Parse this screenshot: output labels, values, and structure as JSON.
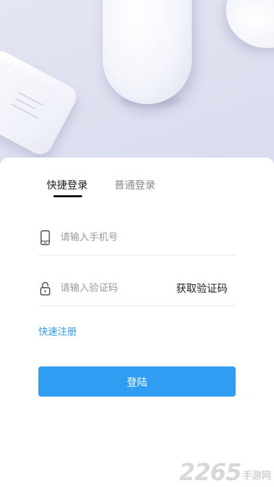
{
  "tabs": [
    {
      "label": "快捷登录",
      "active": true
    },
    {
      "label": "普通登录",
      "active": false
    }
  ],
  "phone_field": {
    "icon": "phone-icon",
    "placeholder": "请输入手机号",
    "value": ""
  },
  "code_field": {
    "icon": "lock-icon",
    "placeholder": "请输入验证码",
    "value": "",
    "get_code_label": "获取验证码"
  },
  "register_link": "快速注册",
  "login_button": "登陆",
  "watermark": {
    "number": "2265",
    "name": "手游网"
  },
  "colors": {
    "accent": "#2f9df2",
    "link": "#2f9af0",
    "active_tab": "#222222",
    "inactive_tab": "#8a8a8a"
  }
}
